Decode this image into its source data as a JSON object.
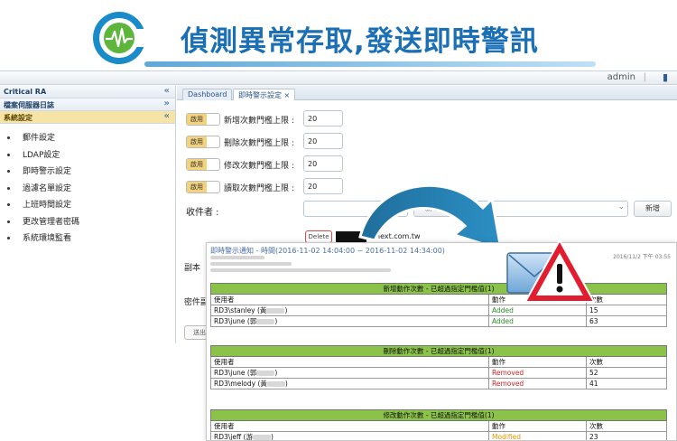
{
  "banner": {
    "title": "偵測異常存取,發送即時警訊"
  },
  "topbar": {
    "user": "admin",
    "separator": "|"
  },
  "sidebar": {
    "app_name": "Critical RA",
    "section1": "檔案伺服器日誌",
    "section2": "系統設定",
    "items": [
      "郵件設定",
      "LDAP設定",
      "即時警示設定",
      "過濾名單設定",
      "上班時間設定",
      "更改管理者密碼",
      "系統環境監看"
    ]
  },
  "tabs": {
    "dashboard": "Dashboard",
    "alert": "即時警示設定 ×"
  },
  "thresholds": [
    {
      "toggle": "啟用",
      "label": "新增次數門檻上限 :",
      "value": "20"
    },
    {
      "toggle": "啟用",
      "label": "刪除次數門檻上限 :",
      "value": "20"
    },
    {
      "toggle": "啟用",
      "label": "修改次數門檻上限 :",
      "value": "20"
    },
    {
      "toggle": "啟用",
      "label": "讀取次數門檻上限 :",
      "value": "20"
    }
  ],
  "recipients": {
    "label": "收件者 :",
    "add_label": "新增",
    "add2_label": "新增",
    "delete_label": "Delete",
    "email_suffix": "@next.com.tw",
    "cc_label": "副本",
    "pw_label": "密件副",
    "send_label": "送出"
  },
  "email": {
    "subject": "即時警示通知 - 時間(2016-11-02 14:04:00 ~ 2016-11-02 14:34:00)",
    "date": "2016/11/2 下午 03:55",
    "tables": [
      {
        "caption": "新增動作次數 - 已超過指定門檻值(1)",
        "headers": [
          "使用者",
          "動作",
          "次數"
        ],
        "rows": [
          {
            "user": "RD3\\stanley (黃",
            "action": "Added",
            "count": "15"
          },
          {
            "user": "RD3\\june (郭",
            "action": "Added",
            "count": "63"
          }
        ]
      },
      {
        "caption": "刪除動作次數 - 已超過指定門檻值(1)",
        "headers": [
          "使用者",
          "動作",
          "次數"
        ],
        "rows": [
          {
            "user": "RD3\\june (郭",
            "action": "Removed",
            "count": "52"
          },
          {
            "user": "RD3\\melody (黃",
            "action": "Removed",
            "count": "41"
          }
        ]
      },
      {
        "caption": "修改動作次數 - 已超過指定門檻值(1)",
        "headers": [
          "使用者",
          "動作",
          "次數"
        ],
        "rows": [
          {
            "user": "RD3\\jeff (游",
            "action": "Modified",
            "count": "23"
          }
        ]
      }
    ]
  },
  "colors": {
    "brand": "#1a6fb5",
    "caption_green": "#8bc34a",
    "added": "#2e8b2e",
    "removed": "#d42020",
    "modified": "#e59800",
    "toggle_on": "#f3d27c"
  }
}
